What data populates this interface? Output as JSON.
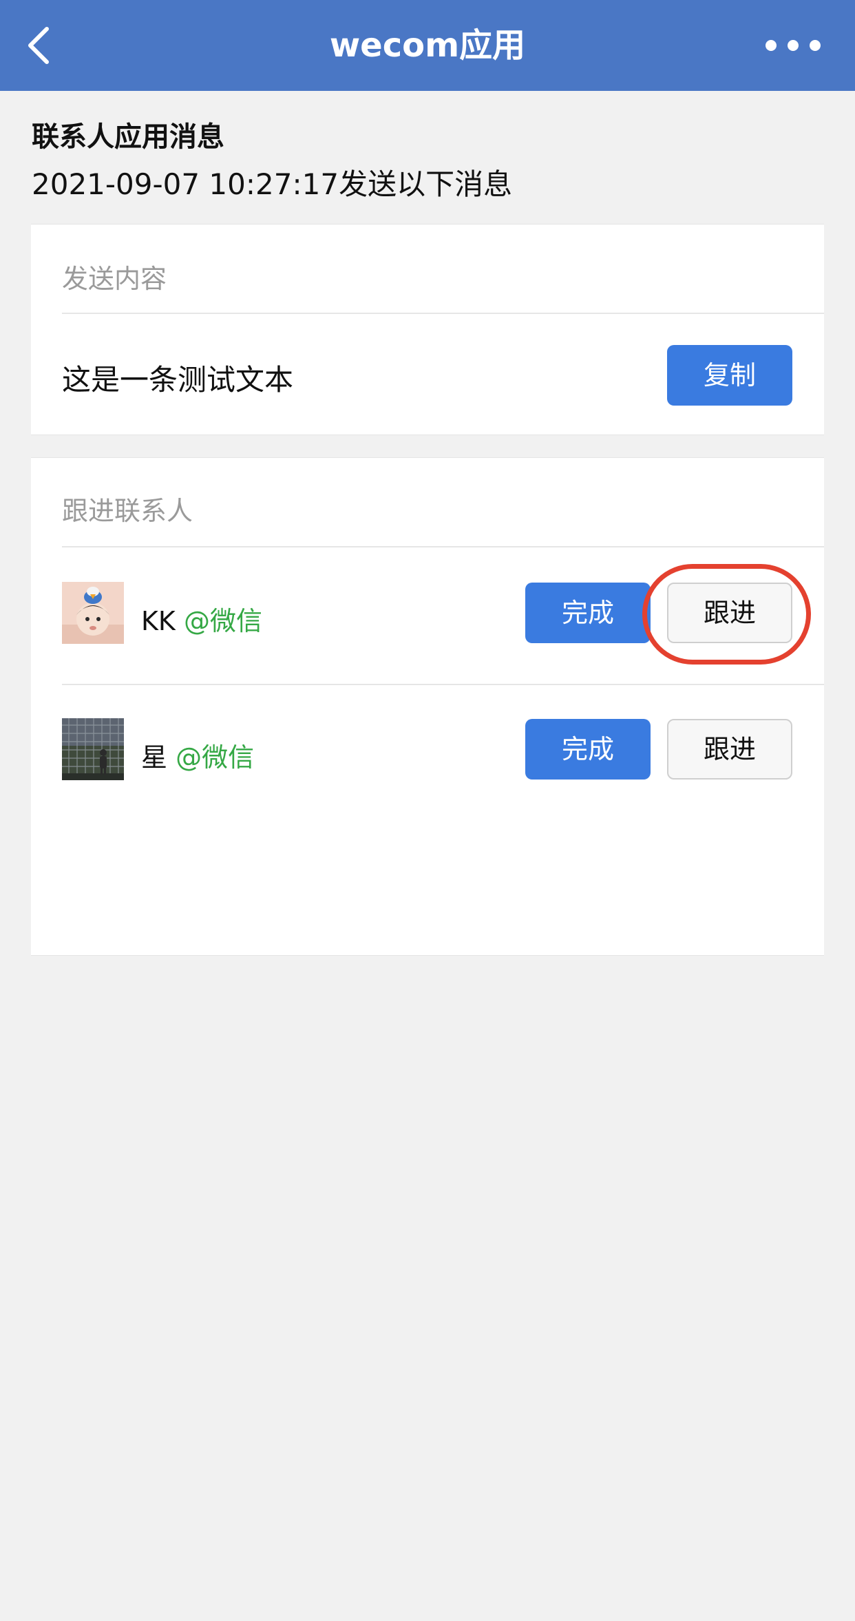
{
  "navbar": {
    "title": "wecom应用",
    "back_icon": "chevron-left-icon",
    "more_icon": "more-dots-icon"
  },
  "message": {
    "title": "联系人应用消息",
    "sent_line": "2021-09-07 10:27:17发送以下消息"
  },
  "content_section": {
    "label": "发送内容",
    "text": "这是一条测试文本",
    "copy_label": "复制"
  },
  "contacts_section": {
    "label": "跟进联系人",
    "contacts": [
      {
        "name": "KK",
        "source": "@微信",
        "done_label": "完成",
        "follow_label": "跟进"
      },
      {
        "name": "星",
        "source": "@微信",
        "done_label": "完成",
        "follow_label": "跟进"
      }
    ]
  },
  "colors": {
    "navbar": "#4a77c5",
    "primary_button": "#3a7be0",
    "source_green": "#35a845",
    "highlight_red": "#e4412f"
  }
}
